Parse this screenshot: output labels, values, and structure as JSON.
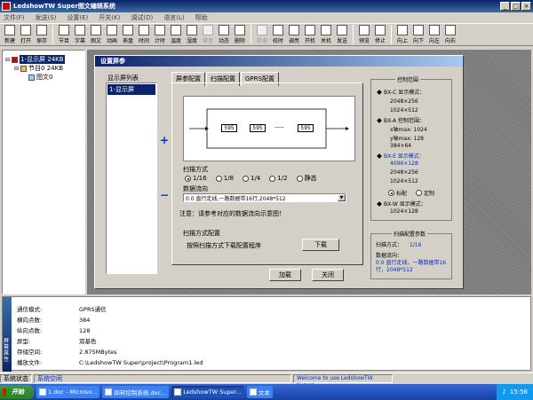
{
  "window": {
    "title": "LedshowTW Super图文编辑系统",
    "buttons": [
      "_",
      "□",
      "×"
    ]
  },
  "menu": [
    "文件(F)",
    "发送(S)",
    "设置(E)",
    "开关(K)",
    "调试(D)",
    "语言(L)",
    "帮助"
  ],
  "toolbar": [
    {
      "label": "新建",
      "icon": "new-file-icon",
      "enabled": true
    },
    {
      "label": "打开",
      "icon": "open-folder-icon",
      "enabled": true
    },
    {
      "label": "保存",
      "icon": "save-icon",
      "enabled": true
    },
    {
      "sep": true
    },
    {
      "label": "节目",
      "icon": "program-icon",
      "enabled": true
    },
    {
      "label": "字幕",
      "icon": "subtitle-icon",
      "enabled": true
    },
    {
      "label": "图文",
      "icon": "image-text-icon",
      "enabled": true
    },
    {
      "label": "动画",
      "icon": "animation-icon",
      "enabled": true
    },
    {
      "label": "表盘",
      "icon": "dial-icon",
      "enabled": true
    },
    {
      "label": "时间",
      "icon": "clock-icon",
      "enabled": true
    },
    {
      "label": "计时",
      "icon": "timer-icon",
      "enabled": true
    },
    {
      "label": "温度",
      "icon": "temperature-icon",
      "enabled": true
    },
    {
      "label": "湿度",
      "icon": "humidity-icon",
      "enabled": true
    },
    {
      "label": "噪音",
      "icon": "noise-icon",
      "enabled": false
    },
    {
      "label": "动态",
      "icon": "dynamic-icon",
      "enabled": true
    },
    {
      "label": "删除",
      "icon": "delete-icon",
      "enabled": true
    },
    {
      "sep": true
    },
    {
      "label": "检测",
      "icon": "detect-icon",
      "enabled": false
    },
    {
      "label": "校时",
      "icon": "sync-time-icon",
      "enabled": true
    },
    {
      "label": "调亮",
      "icon": "brightness-icon",
      "enabled": true
    },
    {
      "label": "开机",
      "icon": "power-on-icon",
      "enabled": true
    },
    {
      "label": "关机",
      "icon": "power-off-icon",
      "enabled": true
    },
    {
      "label": "发送",
      "icon": "send-icon",
      "enabled": true
    },
    {
      "sep": true
    },
    {
      "label": "预览",
      "icon": "preview-icon",
      "enabled": true
    },
    {
      "label": "停止",
      "icon": "stop-icon",
      "enabled": true
    },
    {
      "sep": true
    },
    {
      "label": "向上",
      "icon": "arrow-up-icon",
      "enabled": true
    },
    {
      "label": "向下",
      "icon": "arrow-down-icon",
      "enabled": true
    },
    {
      "label": "向左",
      "icon": "arrow-left-icon",
      "enabled": true
    },
    {
      "label": "向右",
      "icon": "arrow-right-icon",
      "enabled": true
    }
  ],
  "tree": {
    "screen": "1-显示屏 24KB",
    "program": "节目0  24KB",
    "item": "图文0"
  },
  "dialog": {
    "title": "设置屏参",
    "list_label": "显示屏列表",
    "list_item": "1-显示屏",
    "plus": "+",
    "minus": "−",
    "tabs": [
      "屏参配置",
      "扫描配置",
      "GPRS配置"
    ],
    "diagram_boxes": [
      "595",
      "595",
      "595"
    ],
    "diagram_dots": "-----",
    "scan_mode_label": "扫描方式",
    "scan_options": [
      "1/16",
      "1/8",
      "1/4",
      "1/2",
      "静态"
    ],
    "scan_selected": 0,
    "data_flow_label": "数据流向",
    "data_flow_value": "0.0 直行走线,一路数据带16行,2048*512",
    "note": "注意：请参考对应的数据流向示意图！",
    "scan_config_label": "扫描方式配置",
    "scan_config_text": "按照扫描方式下载配置程序",
    "download_btn": "下载",
    "load_btn": "加载",
    "close_btn": "关闭",
    "control_range": {
      "title": "控制范围",
      "a_label": "BX-C 显示模式：",
      "a_val1": "2048×256",
      "a_val2": "1024×512",
      "b_label": "BX-A 控制范围：",
      "b_val1": "x轴max: 1024",
      "b_val2": "y轴max: 128",
      "b_val3": "384×64",
      "c_label": "BX-E 显示模式：",
      "c_val1": "4096×128",
      "c_val2": "2048×256",
      "c_val3": "1024×512",
      "radio_std": "标配",
      "radio_custom": "定制",
      "d_label": "BX-W 显示模式：",
      "d_val1": "1024×128"
    },
    "scan_params": {
      "title": "扫描配置参数",
      "mode_label": "扫描方式：",
      "mode_value": "1/16",
      "flow_label": "数据流向：",
      "flow_value": "0.0 直行走线，一路数据带16行，2048*512"
    }
  },
  "properties": {
    "side_label": "屏幕属性",
    "rows": [
      {
        "k": "通信模式:",
        "v": "GPRS通信"
      },
      {
        "k": "横向点数:",
        "v": "384"
      },
      {
        "k": "纵向点数:",
        "v": "128"
      },
      {
        "k": "屏型:",
        "v": "双基色"
      },
      {
        "k": "存储空间:",
        "v": "2.875MBytes"
      },
      {
        "k": "播放文件:",
        "v": "C:\\LedshowTW Super\\project\\Program1.led"
      }
    ]
  },
  "status": {
    "label": "系统状态",
    "value": "系统空闲",
    "welcome": "Welcome to use LedshowTW Super!"
  },
  "taskbar": {
    "start": "开始",
    "tasks": [
      "1.doc - Microso...",
      "抑邦控制系统.doc...",
      "LedshowTW Super...",
      "文本"
    ],
    "active": 2,
    "time": "15:56"
  }
}
